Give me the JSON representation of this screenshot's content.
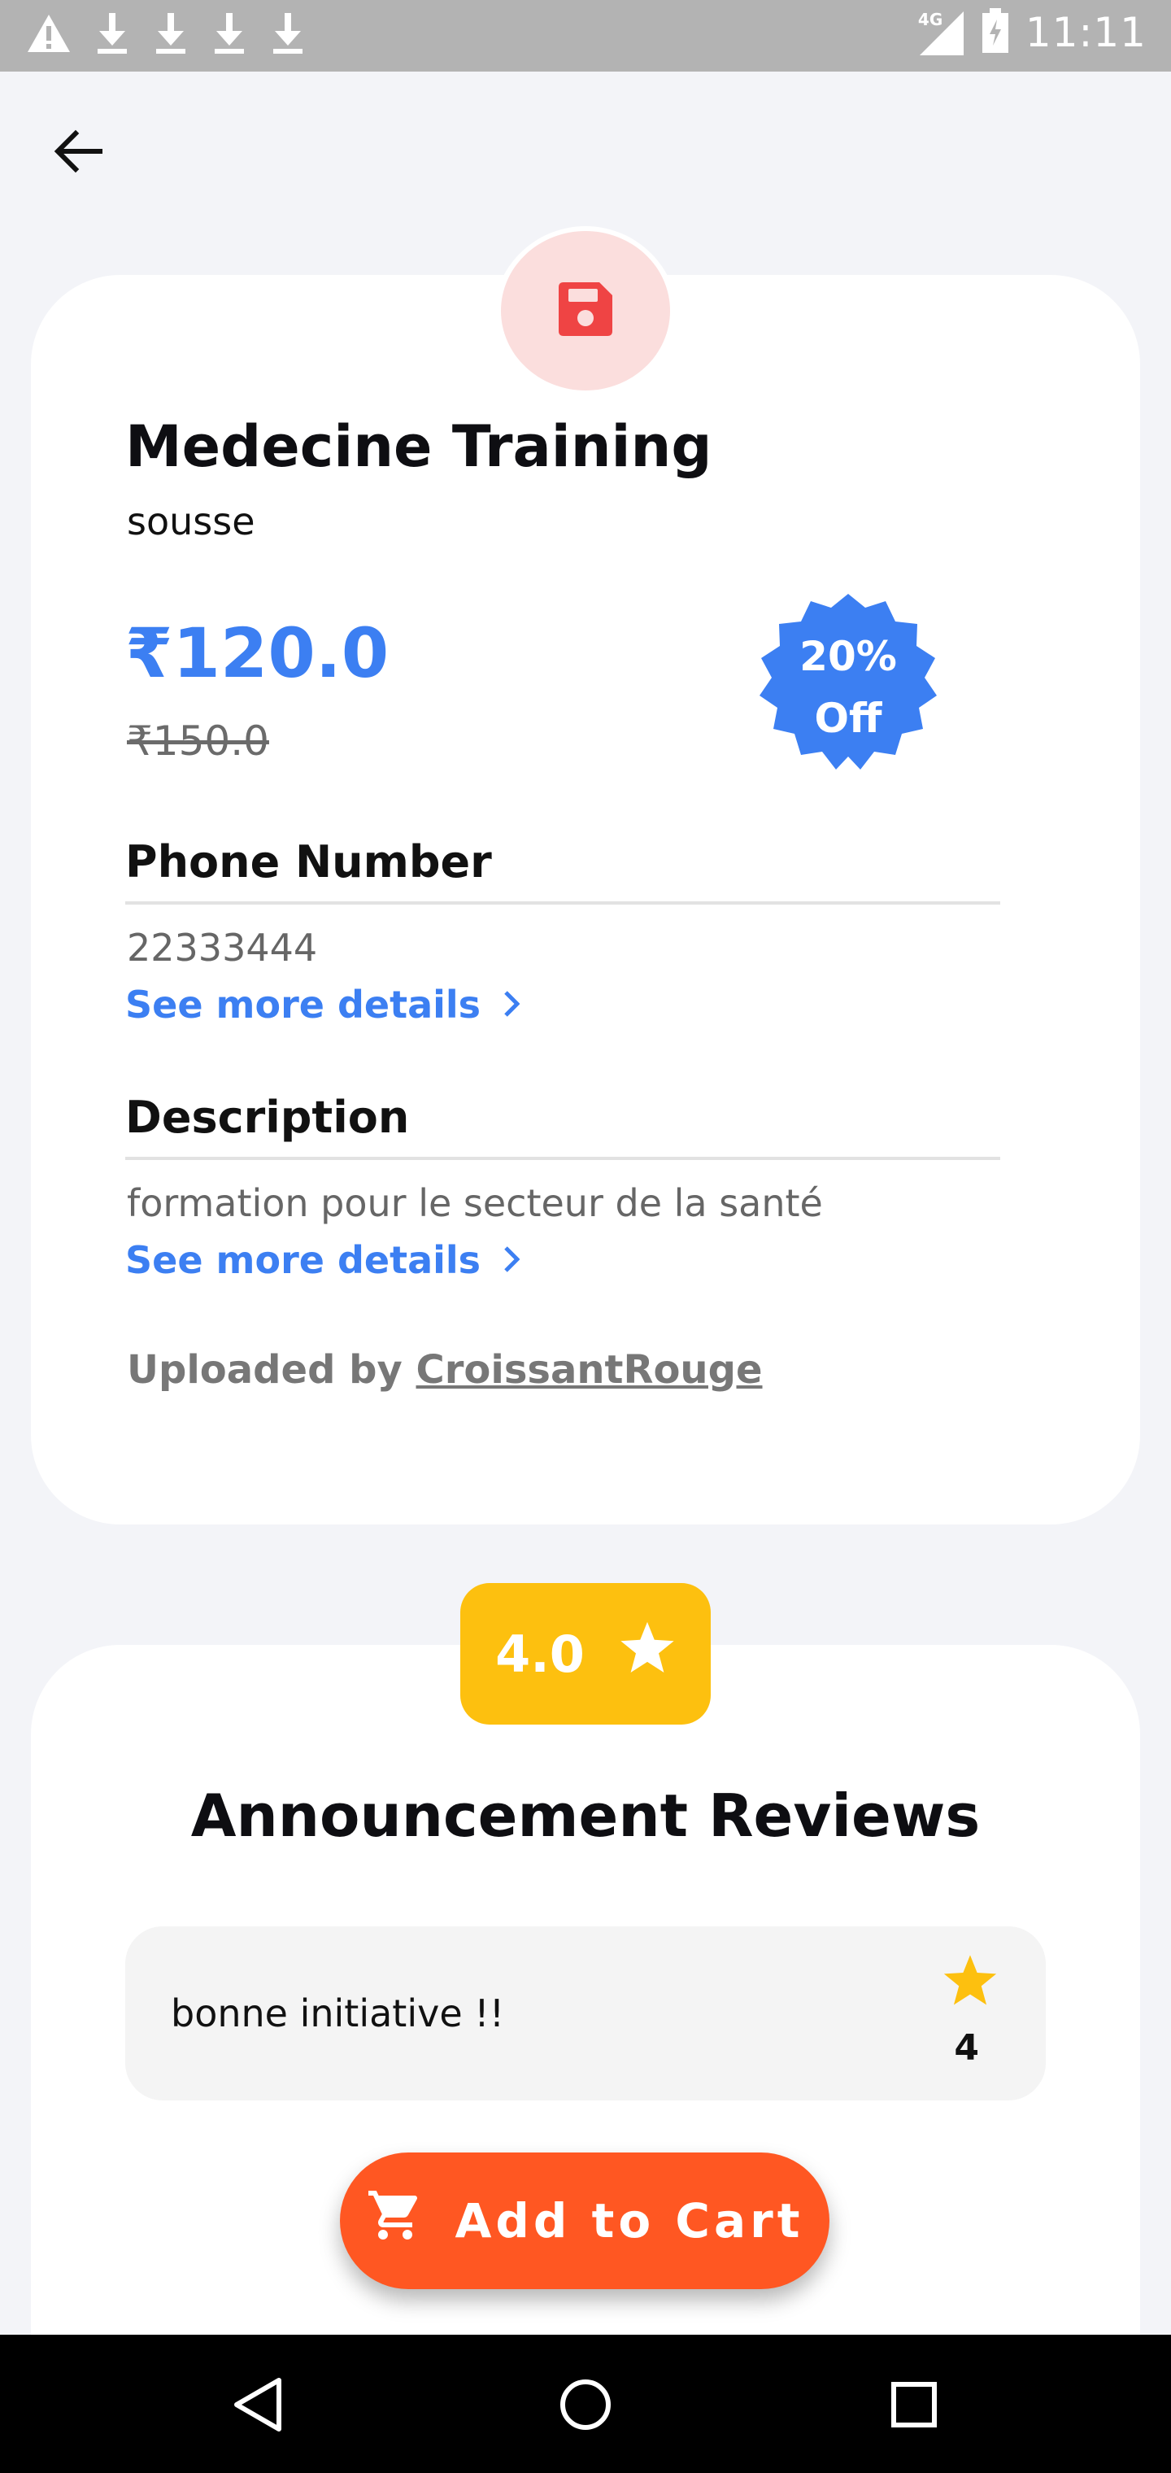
{
  "status_bar": {
    "time": "11:11",
    "network": "4G",
    "icons": [
      "warning-icon",
      "download-icon",
      "download-icon",
      "download-icon",
      "download-icon",
      "signal-icon",
      "battery-icon"
    ]
  },
  "header": {
    "back_icon": "arrow-left-icon"
  },
  "announcement": {
    "icon": "save-icon",
    "title": "Medecine Training",
    "location": "sousse",
    "price": "₹120.0",
    "old_price": "₹150.0",
    "discount": {
      "line1": "20%",
      "line2": "Off"
    },
    "phone": {
      "heading": "Phone Number",
      "value": "22333444",
      "more_label": "See more details"
    },
    "description": {
      "heading": "Description",
      "value": "formation pour le secteur de la santé",
      "more_label": "See more details"
    },
    "uploaded_prefix": "Uploaded by",
    "uploader": "CroissantRouge"
  },
  "rating": {
    "value": "4.0",
    "icon": "star-icon"
  },
  "reviews": {
    "title": "Announcement Reviews",
    "items": [
      {
        "text": "bonne initiative !!",
        "rating": "4"
      }
    ]
  },
  "cart_button": {
    "label": "Add to Cart",
    "icon": "cart-icon"
  },
  "colors": {
    "accent_blue": "#3c7ff2",
    "cart_orange": "#ff5722",
    "rating_yellow": "#fdc00f",
    "save_red": "#ef4444"
  }
}
